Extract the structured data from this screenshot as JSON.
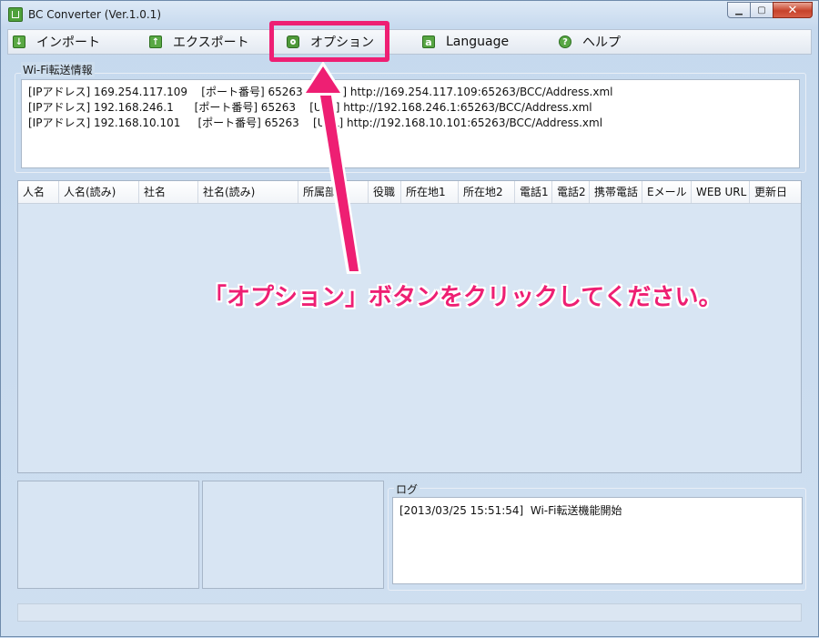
{
  "window": {
    "title": "BC Converter (Ver.1.0.1)"
  },
  "menu": {
    "items": [
      {
        "label": "インポート",
        "icon": "import-icon"
      },
      {
        "label": "エクスポート",
        "icon": "export-icon"
      },
      {
        "label": "オプション",
        "icon": "option-gear-icon"
      },
      {
        "label": "Language",
        "icon": "language-icon"
      },
      {
        "label": "ヘルプ",
        "icon": "help-icon"
      }
    ],
    "highlighted": "オプション"
  },
  "wifi": {
    "group_label": "Wi-Fi転送情報",
    "lines": [
      "[IPアドレス] 169.254.117.109    [ポート番号] 65263    [URL] http://169.254.117.109:65263/BCC/Address.xml",
      "[IPアドレス] 192.168.246.1      [ポート番号] 65263    [URL] http://192.168.246.1:65263/BCC/Address.xml",
      "[IPアドレス] 192.168.10.101     [ポート番号] 65263    [URL] http://192.168.10.101:65263/BCC/Address.xml"
    ]
  },
  "grid": {
    "columns": [
      "人名",
      "人名(読み)",
      "社名",
      "社名(読み)",
      "所属部署",
      "役職",
      "所在地1",
      "所在地2",
      "電話1",
      "電話2",
      "携帯電話",
      "Eメール",
      "WEB URL",
      "更新日"
    ],
    "rows": []
  },
  "callout": {
    "text": "「オプション」ボタンをクリックしてください。"
  },
  "log": {
    "label": "ログ",
    "entries": [
      "[2013/03/25 15:51:54]  Wi-Fi転送機能開始"
    ]
  },
  "colors": {
    "highlight": "#ee1f73",
    "accent_green": "#59a844"
  }
}
